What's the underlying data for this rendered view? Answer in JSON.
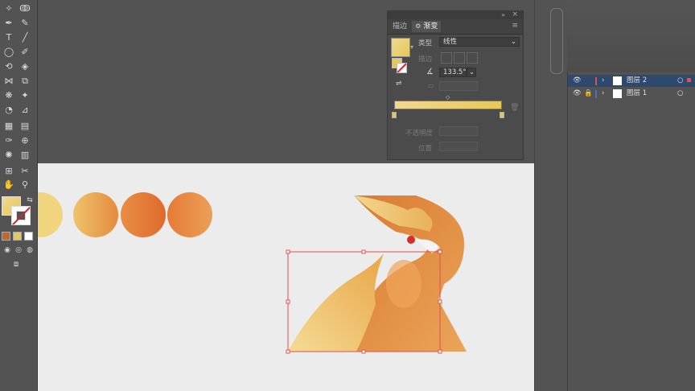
{
  "gradient_panel": {
    "tabs": [
      {
        "label": "描边"
      },
      {
        "label": "渐变"
      }
    ],
    "type_label": "类型",
    "type_value": "线性",
    "stroke_label": "描边",
    "angle_value": "133.5°",
    "opacity_label": "不透明度",
    "position_label": "位置"
  },
  "layers_panel": {
    "layers": [
      {
        "name": "图层 2",
        "selected": true
      },
      {
        "name": "图层 1",
        "selected": false
      }
    ]
  },
  "colors": {
    "accent_gradient_start": "#f0d891",
    "accent_gradient_end": "#e6c75a",
    "selection": "#e05050",
    "layer2_color": "#e05050",
    "layer1_color": "#4a70c8"
  }
}
